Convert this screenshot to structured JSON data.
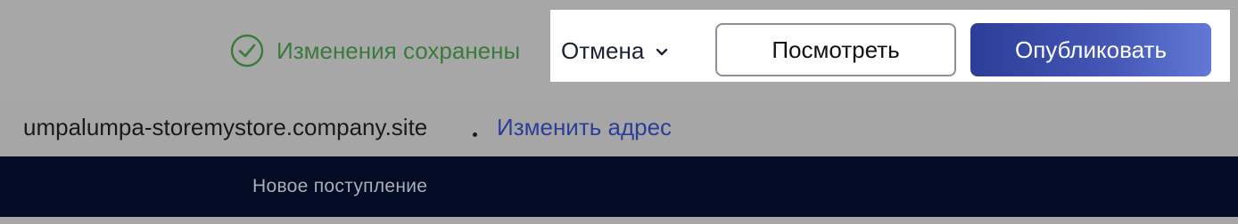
{
  "toolbar": {
    "saved_status": "Изменения сохранены",
    "saved_icon": "check-circle-icon",
    "cancel_label": "Отмена",
    "cancel_icon": "chevron-down-icon",
    "preview_label": "Посмотреть",
    "publish_label": "Опубликовать"
  },
  "address": {
    "site_url": "umpalumpa-storemystore.company.site",
    "change_link": "Изменить адрес"
  },
  "store_nav": {
    "items": [
      {
        "label": "Новое поступление"
      }
    ]
  },
  "colors": {
    "success": "#3a7a3c",
    "accent": "#2b3d96",
    "link": "#2a3e9a",
    "nav_background": "#020c24"
  }
}
